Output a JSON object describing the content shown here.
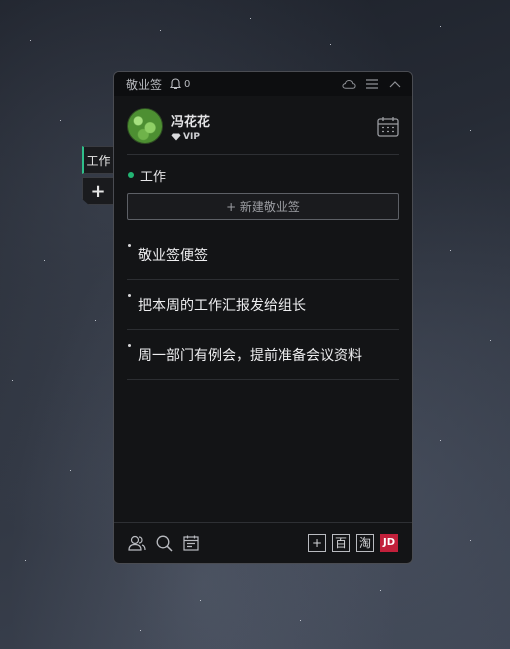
{
  "titlebar": {
    "app_name": "敬业签",
    "notification_count": "0"
  },
  "user": {
    "name": "冯花花",
    "badge": "VIP"
  },
  "side_tabs": {
    "active_label": "工作",
    "add_label": "+"
  },
  "category": {
    "name": "工作",
    "dot_color": "#22b573"
  },
  "new_note_label": "+ 新建敬业签",
  "notes": [
    {
      "text": "敬业签便签"
    },
    {
      "text": "把本周的工作汇报发给组长"
    },
    {
      "text": "周一部门有例会，提前准备会议资料"
    }
  ],
  "bottom_buttons": {
    "add": "+",
    "baidu": "百",
    "taobao": "淘",
    "jd": "JD"
  },
  "colors": {
    "accent": "#2fbf8a",
    "jd_red": "#c2203b"
  }
}
